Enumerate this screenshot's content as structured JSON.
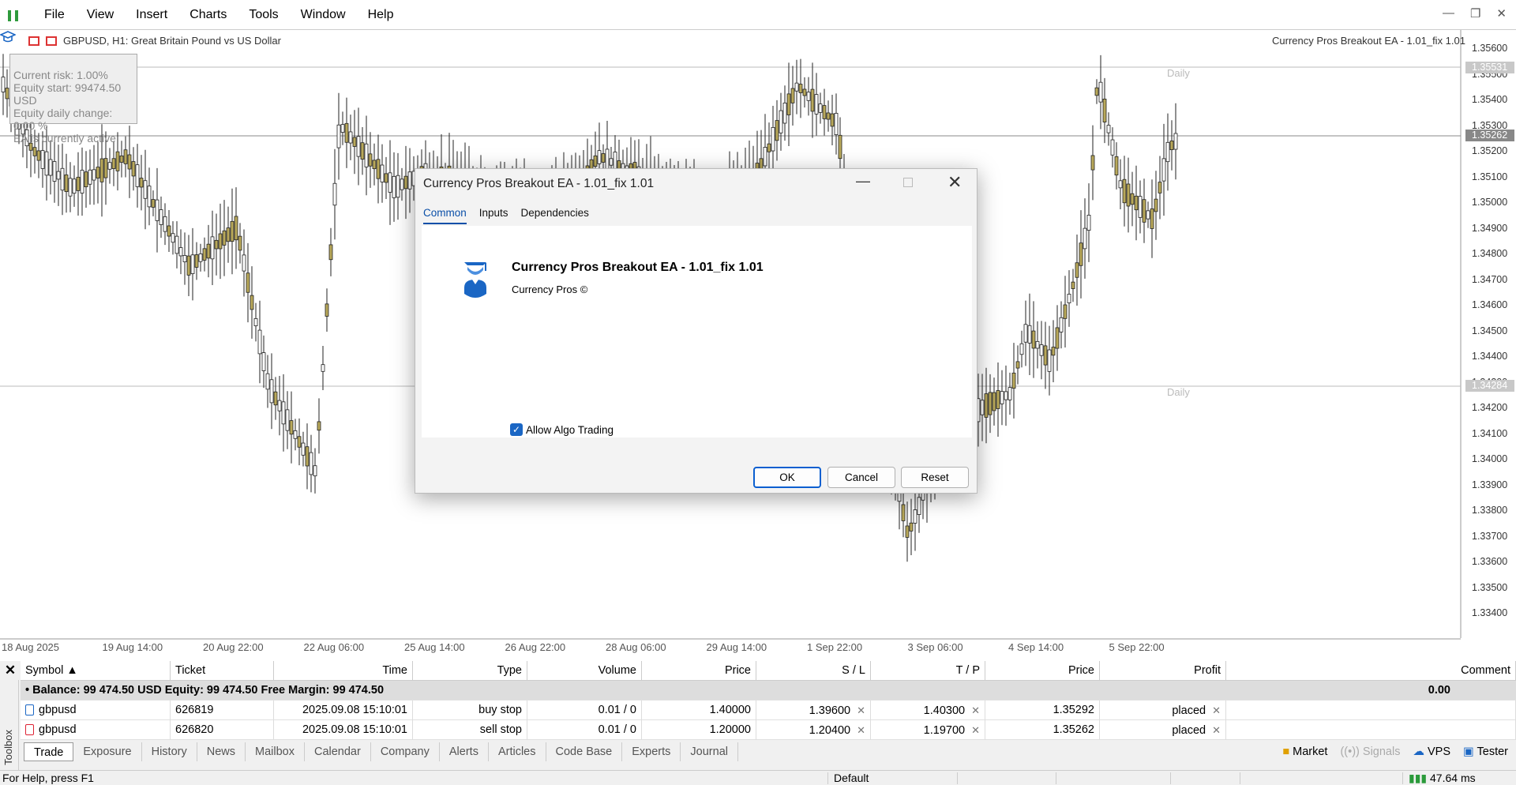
{
  "menu": [
    "File",
    "View",
    "Insert",
    "Charts",
    "Tools",
    "Window",
    "Help"
  ],
  "chart": {
    "title": "GBPUSD, H1:  Great Britain Pound vs US Dollar",
    "ea_label": "Currency Pros Breakout EA - 1.01_fix 1.01",
    "info": [
      "Current risk: 1.00%",
      "Equity start: 99474.50 USD",
      "Equity daily change: 0.00 %",
      "EA is currently active"
    ],
    "daily_label": "Daily",
    "price_labels": [
      "1.35600",
      "1.35500",
      "1.35400",
      "1.35300",
      "1.35200",
      "1.35100",
      "1.35000",
      "1.34900",
      "1.34800",
      "1.34700",
      "1.34600",
      "1.34500",
      "1.34400",
      "1.34300",
      "1.34200",
      "1.34100",
      "1.34000",
      "1.33900",
      "1.33800",
      "1.33700",
      "1.33600",
      "1.33500",
      "1.33400"
    ],
    "hl_high": "1.35531",
    "hl_current": "1.35262",
    "hl_low": "1.34284",
    "time_labels": [
      "18 Aug 2025",
      "19 Aug 14:00",
      "20 Aug 22:00",
      "22 Aug 06:00",
      "25 Aug 14:00",
      "26 Aug 22:00",
      "28 Aug 06:00",
      "29 Aug 14:00",
      "1 Sep 22:00",
      "3 Sep 06:00",
      "4 Sep 14:00",
      "5 Sep 22:00"
    ],
    "colors": {
      "up": "#b8a85a",
      "down": "#222222",
      "grid": "#cccccc"
    }
  },
  "dialog": {
    "title": "Currency Pros Breakout EA - 1.01_fix 1.01",
    "tabs": [
      "Common",
      "Inputs",
      "Dependencies"
    ],
    "ea_name": "Currency Pros Breakout EA - 1.01_fix 1.01",
    "author": "Currency Pros ©",
    "algo_label": "Allow Algo Trading",
    "ok": "OK",
    "cancel": "Cancel",
    "reset": "Reset"
  },
  "toolbox": {
    "side_label": "Toolbox",
    "headers": [
      "Symbol",
      "Ticket",
      "Time",
      "Type",
      "Volume",
      "Price",
      "S / L",
      "T / P",
      "Price",
      "Profit",
      "Comment"
    ],
    "balance": "Balance: 99 474.50 USD  Equity: 99 474.50  Free Margin: 99 474.50",
    "balance_profit": "0.00",
    "rows": [
      {
        "symbol": "gbpusd",
        "ticket": "626819",
        "time": "2025.09.08 15:10:01",
        "type": "buy stop",
        "volume": "0.01 / 0",
        "price": "1.40000",
        "sl": "1.39600",
        "tp": "1.40300",
        "cur": "1.35292",
        "profit": "placed"
      },
      {
        "symbol": "gbpusd",
        "ticket": "626820",
        "time": "2025.09.08 15:10:01",
        "type": "sell stop",
        "volume": "0.01 / 0",
        "price": "1.20000",
        "sl": "1.20400",
        "tp": "1.19700",
        "cur": "1.35262",
        "profit": "placed"
      }
    ],
    "tabs": [
      "Trade",
      "Exposure",
      "History",
      "News",
      "Mailbox",
      "Calendar",
      "Company",
      "Alerts",
      "Articles",
      "Code Base",
      "Experts",
      "Journal"
    ],
    "right": [
      "Market",
      "Signals",
      "VPS",
      "Tester"
    ]
  },
  "status": {
    "help": "For Help, press F1",
    "profile": "Default",
    "ping": "47.64 ms"
  }
}
